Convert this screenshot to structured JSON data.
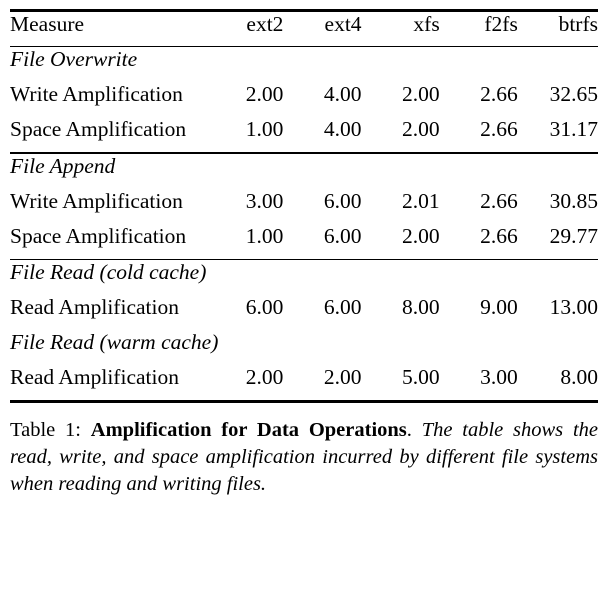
{
  "table": {
    "columns": [
      "Measure",
      "ext2",
      "ext4",
      "xfs",
      "f2fs",
      "btrfs"
    ],
    "header": {
      "measure": "Measure",
      "ext2": "ext2",
      "ext4": "ext4",
      "xfs": "xfs",
      "f2fs": "f2fs",
      "btrfs": "btrfs"
    },
    "sections": [
      {
        "label": "File Overwrite",
        "rows": [
          {
            "measure": "Write Amplification",
            "ext2": "2.00",
            "ext4": "4.00",
            "xfs": "2.00",
            "f2fs": "2.66",
            "btrfs": "32.65"
          },
          {
            "measure": "Space Amplification",
            "ext2": "1.00",
            "ext4": "4.00",
            "xfs": "2.00",
            "f2fs": "2.66",
            "btrfs": "31.17"
          }
        ]
      },
      {
        "label": "File Append",
        "rows": [
          {
            "measure": "Write Amplification",
            "ext2": "3.00",
            "ext4": "6.00",
            "xfs": "2.01",
            "f2fs": "2.66",
            "btrfs": "30.85"
          },
          {
            "measure": "Space Amplification",
            "ext2": "1.00",
            "ext4": "6.00",
            "xfs": "2.00",
            "f2fs": "2.66",
            "btrfs": "29.77"
          }
        ]
      },
      {
        "label": "File Read (cold cache)",
        "rows": [
          {
            "measure": "Read Amplification",
            "ext2": "6.00",
            "ext4": "6.00",
            "xfs": "8.00",
            "f2fs": "9.00",
            "btrfs": "13.00"
          }
        ]
      },
      {
        "label": "File Read (warm cache)",
        "rows": [
          {
            "measure": "Read Amplification",
            "ext2": "2.00",
            "ext4": "2.00",
            "xfs": "5.00",
            "f2fs": "3.00",
            "btrfs": "8.00"
          }
        ]
      }
    ]
  },
  "caption": {
    "lead": "Table 1:",
    "title": "Amplification for Data Operations",
    "separator": ".",
    "body": "The table shows the read, write, and space amplification incurred by different file systems when reading and writing files."
  },
  "chart_data": {
    "type": "table",
    "title": "Amplification for Data Operations",
    "columns": [
      "Measure",
      "ext2",
      "ext4",
      "xfs",
      "f2fs",
      "btrfs"
    ],
    "rows": [
      {
        "group": "File Overwrite",
        "measure": "Write Amplification",
        "values": [
          2.0,
          4.0,
          2.0,
          2.66,
          32.65
        ]
      },
      {
        "group": "File Overwrite",
        "measure": "Space Amplification",
        "values": [
          1.0,
          4.0,
          2.0,
          2.66,
          31.17
        ]
      },
      {
        "group": "File Append",
        "measure": "Write Amplification",
        "values": [
          3.0,
          6.0,
          2.01,
          2.66,
          30.85
        ]
      },
      {
        "group": "File Append",
        "measure": "Space Amplification",
        "values": [
          1.0,
          6.0,
          2.0,
          2.66,
          29.77
        ]
      },
      {
        "group": "File Read (cold cache)",
        "measure": "Read Amplification",
        "values": [
          6.0,
          6.0,
          8.0,
          9.0,
          13.0
        ]
      },
      {
        "group": "File Read (warm cache)",
        "measure": "Read Amplification",
        "values": [
          2.0,
          2.0,
          5.0,
          3.0,
          8.0
        ]
      }
    ]
  }
}
